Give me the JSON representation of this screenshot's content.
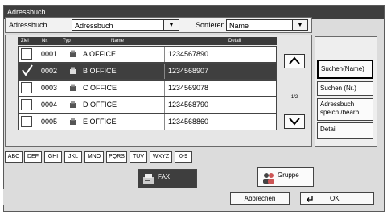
{
  "window": {
    "title": "Adressbuch"
  },
  "filter": {
    "addressbook_label": "Adressbuch",
    "addressbook_value": "Adressbuch",
    "sort_label": "Sortieren",
    "sort_value": "Name"
  },
  "table": {
    "headers": {
      "ziel": "Ziel",
      "nr": "Nr.",
      "typ": "Typ",
      "name": "Name",
      "detail": "Detail"
    },
    "rows": [
      {
        "nr": "0001",
        "name": "A OFFICE",
        "detail": "1234567890",
        "checked": false
      },
      {
        "nr": "0002",
        "name": "B OFFICE",
        "detail": "1234568907",
        "checked": true
      },
      {
        "nr": "0003",
        "name": "C OFFICE",
        "detail": "1234569078",
        "checked": false
      },
      {
        "nr": "0004",
        "name": "D OFFICE",
        "detail": "1234568790",
        "checked": false
      },
      {
        "nr": "0005",
        "name": "E OFFICE",
        "detail": "1234568860",
        "checked": false
      }
    ],
    "page_indicator": "1/2"
  },
  "side_buttons": {
    "search_name": "Suchen(Name)",
    "search_nr": "Suchen (Nr.)",
    "edit_line1": "Adressbuch",
    "edit_line2": "speich./bearb.",
    "detail": "Detail"
  },
  "index_keys": [
    "ABC",
    "DEF",
    "GHI",
    "JKL",
    "MNO",
    "PQRS",
    "TUV",
    "WXYZ",
    "0-9"
  ],
  "group_buttons": {
    "fax": "FAX",
    "gruppe": "Gruppe"
  },
  "footer": {
    "cancel": "Abbrechen",
    "ok": "OK"
  },
  "icons": {
    "scroll_up": "chevron-up-icon",
    "scroll_down": "chevron-down-icon",
    "fax_type": "fax-machine-icon",
    "group": "group-people-icon",
    "enter": "enter-arrow-icon"
  },
  "colors": {
    "title_bg": "#3e3e3e",
    "selected_row": "#3f3f3f",
    "panel": "#dcdcdc"
  }
}
